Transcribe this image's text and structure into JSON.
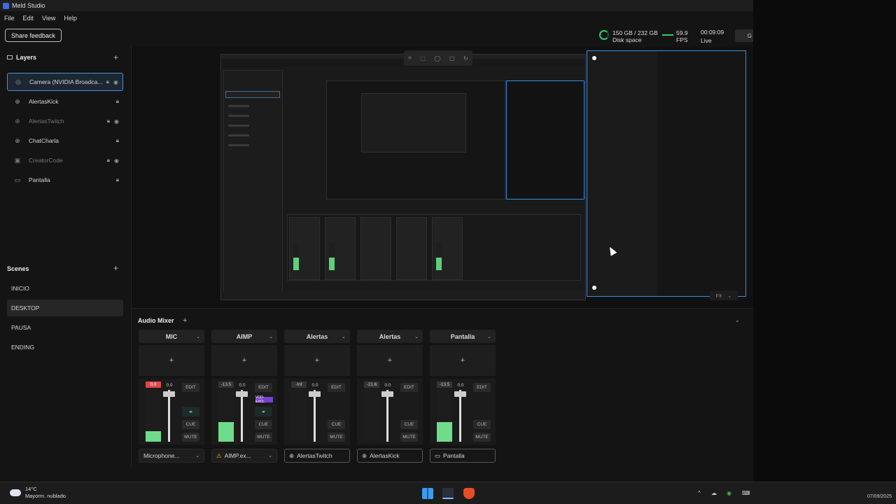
{
  "window": {
    "title": "Meld Studio"
  },
  "menu": [
    "File",
    "Edit",
    "View",
    "Help"
  ],
  "toolbar": {
    "feedback_label": "Share feedback",
    "disk_value": "150 GB / 232 GB",
    "disk_label": "Disk space",
    "fps_value": "59.9",
    "fps_label": "FPS",
    "live_time": "00:09:09",
    "live_label": "Live",
    "go_label": "G"
  },
  "layers": {
    "title": "Layers",
    "items": [
      {
        "name": "Camera (NVIDIA Broadca...",
        "icon": "camera-icon",
        "selected": true,
        "dim": false
      },
      {
        "name": "AlertasKick",
        "icon": "globe-icon",
        "selected": false,
        "dim": false
      },
      {
        "name": "AlertasTwitch",
        "icon": "globe-icon",
        "selected": false,
        "dim": true
      },
      {
        "name": "ChatCharla",
        "icon": "globe-icon",
        "selected": false,
        "dim": false
      },
      {
        "name": "CreatorCode",
        "icon": "image-icon",
        "selected": false,
        "dim": true
      },
      {
        "name": "Pantalla",
        "icon": "monitor-icon",
        "selected": false,
        "dim": false
      }
    ]
  },
  "scenes": {
    "title": "Scenes",
    "items": [
      "INICIO",
      "DESKTOP",
      "PAUSA",
      "ENDING"
    ],
    "selected": "DESKTOP"
  },
  "preview": {
    "fit_label": "Fit"
  },
  "mixer": {
    "title": "Audio Mixer",
    "strips": [
      {
        "name": "MIC",
        "peak": "0.0",
        "gain": "0.0",
        "level": 0.2,
        "footer": "Microphone...",
        "footer_icon": "",
        "dropdown": true,
        "link": true,
        "vod": false
      },
      {
        "name": "AIMP",
        "peak": "-13.5",
        "gain": "0.0",
        "level": 0.37,
        "footer": "AIMP.ex...",
        "footer_icon": "warning-icon",
        "dropdown": true,
        "link": true,
        "vod": true
      },
      {
        "name": "Alertas",
        "peak": "-Inf",
        "gain": "0.0",
        "level": 0.0,
        "footer": "AlertasTwitch",
        "footer_icon": "globe-icon",
        "dropdown": false,
        "link": false,
        "vod": false
      },
      {
        "name": "Alertas",
        "peak": "-21.6",
        "gain": "0.0",
        "level": 0.0,
        "footer": "AlertasKick",
        "footer_icon": "globe-icon",
        "dropdown": false,
        "link": false,
        "vod": false
      },
      {
        "name": "Pantalla",
        "peak": "-13.5",
        "gain": "0.0",
        "level": 0.37,
        "footer": "Pantalla",
        "footer_icon": "monitor-icon",
        "dropdown": false,
        "link": false,
        "vod": false
      }
    ],
    "edit_label": "EDIT",
    "cue_label": "CUE",
    "mute_label": "MUTE",
    "vod_label": "VOD-EXCL"
  },
  "taskbar": {
    "temp": "14°C",
    "weather": "Mayorm. nublado",
    "date": "07/09/2025"
  }
}
